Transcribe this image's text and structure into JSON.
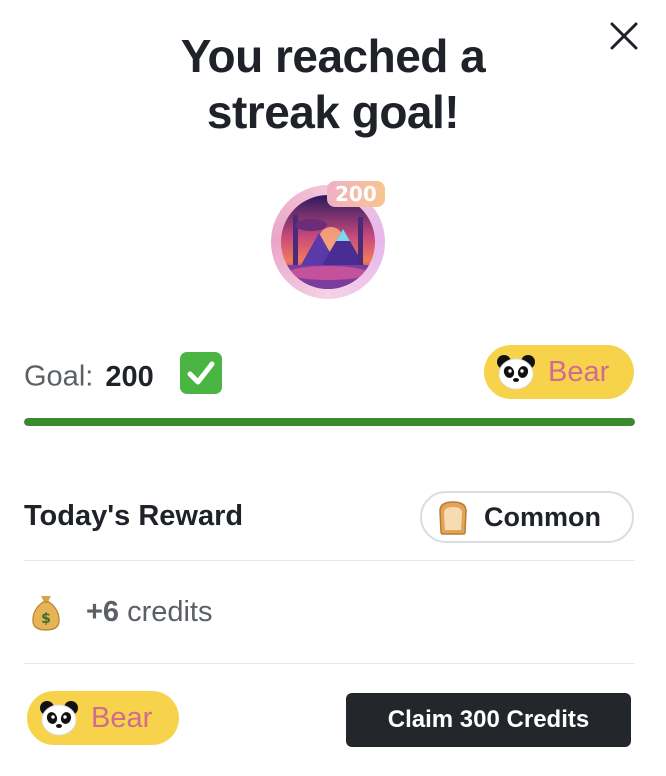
{
  "title_lines": [
    "You reached a",
    "streak goal!"
  ],
  "badge": {
    "streak_number": "200"
  },
  "goal": {
    "label": "Goal:",
    "value": "200",
    "check_icon": "white-heavy-check-mark-icon",
    "progress": 1.0,
    "progress_color": "#3a8b2e",
    "tier": {
      "icon": "panda-icon",
      "label": "Bear"
    }
  },
  "reward": {
    "title": "Today's Reward",
    "rarity": {
      "icon": "bread-icon",
      "label": "Common"
    },
    "credits": {
      "icon": "money-bag-icon",
      "amount": "+6",
      "unit": "credits"
    }
  },
  "footer": {
    "tier": {
      "icon": "panda-icon",
      "label": "Bear"
    },
    "claim_button": "Claim 300 Credits"
  },
  "colors": {
    "pill_bg": "#f7d34b",
    "pill_text": "#d26b92",
    "button_bg": "#23272b"
  }
}
